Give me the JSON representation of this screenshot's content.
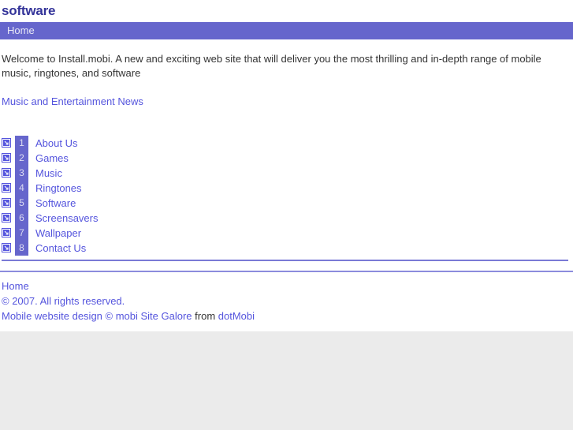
{
  "header": {
    "title": "software",
    "nav": {
      "home_label": "Home"
    }
  },
  "main": {
    "intro": "Welcome to Install.mobi. A new and exciting web site that will deliver you the most thrilling and in-depth range of mobile music, ringtones, and software",
    "news_link": "Music and Entertainment News",
    "list": [
      {
        "num": "1",
        "label": "About Us"
      },
      {
        "num": "2",
        "label": "Games"
      },
      {
        "num": "3",
        "label": "Music"
      },
      {
        "num": "4",
        "label": "Ringtones"
      },
      {
        "num": "5",
        "label": "Software"
      },
      {
        "num": "6",
        "label": "Screensavers"
      },
      {
        "num": "7",
        "label": "Wallpaper"
      },
      {
        "num": "8",
        "label": "Contact Us"
      }
    ]
  },
  "footer": {
    "home_label": "Home",
    "copyright": "© 2007. All rights reserved.",
    "credit_link": "Mobile website design © mobi Site Galore",
    "credit_middle": "from",
    "credit_link2": "dotMobi"
  },
  "colors": {
    "accent": "#6666cc",
    "title": "#333399",
    "link": "#5555dd",
    "text": "#333333",
    "page_bg": "#ffffff",
    "outside_bg": "#ebebeb"
  }
}
